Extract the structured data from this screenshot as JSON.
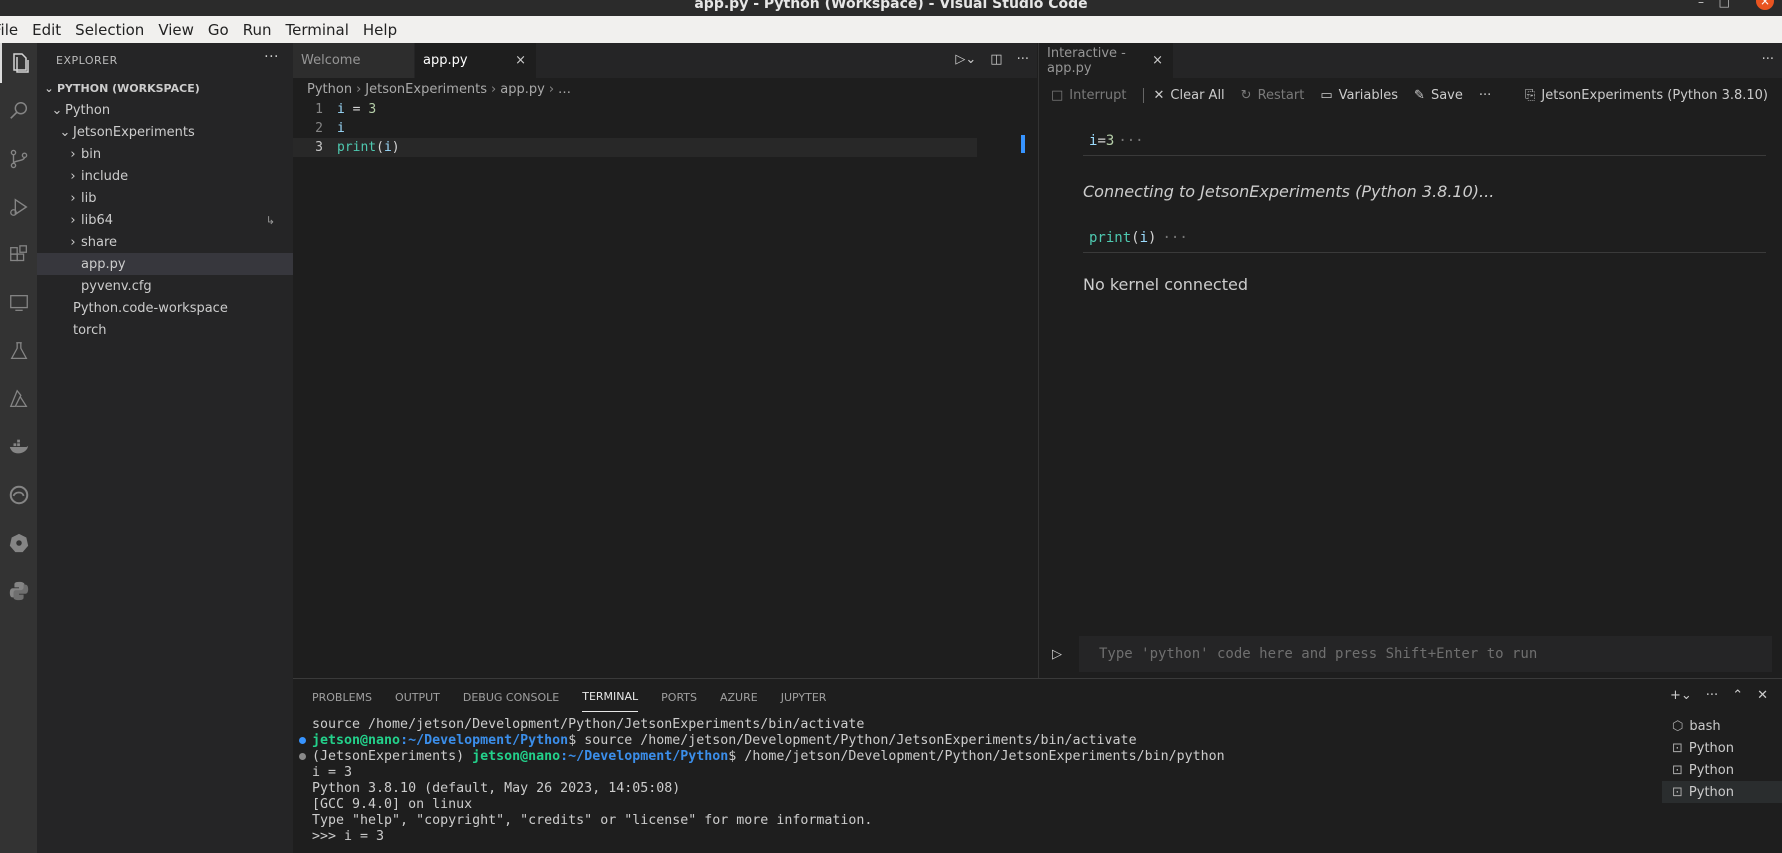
{
  "window": {
    "title": "app.py - Python (Workspace) - Visual Studio Code"
  },
  "menu": [
    "File",
    "Edit",
    "Selection",
    "View",
    "Go",
    "Run",
    "Terminal",
    "Help"
  ],
  "activity_icons": [
    "explorer-icon",
    "search-icon",
    "source-control-icon",
    "run-debug-icon",
    "extensions-icon",
    "remote-explorer-icon",
    "testing-icon",
    "azure-icon",
    "docker-icon",
    "edge-icon",
    "kubernetes-icon",
    "python-icon"
  ],
  "sidebar": {
    "title": "EXPLORER",
    "section": "PYTHON (WORKSPACE)",
    "items": [
      {
        "label": "Python",
        "indent": 1,
        "chev": "down"
      },
      {
        "label": "JetsonExperiments",
        "indent": 2,
        "chev": "down"
      },
      {
        "label": "bin",
        "indent": 3,
        "chev": "right"
      },
      {
        "label": "include",
        "indent": 3,
        "chev": "right"
      },
      {
        "label": "lib",
        "indent": 3,
        "chev": "right"
      },
      {
        "label": "lib64",
        "indent": 3,
        "chev": "right",
        "badge": "↳"
      },
      {
        "label": "share",
        "indent": 3,
        "chev": "right"
      },
      {
        "label": "app.py",
        "indent": 3,
        "chev": "",
        "selected": true
      },
      {
        "label": "pyvenv.cfg",
        "indent": 3,
        "chev": ""
      },
      {
        "label": "Python.code-workspace",
        "indent": 2,
        "chev": ""
      },
      {
        "label": "torch",
        "indent": 2,
        "chev": ""
      }
    ]
  },
  "editor": {
    "tabs": [
      {
        "label": "Welcome",
        "active": false
      },
      {
        "label": "app.py",
        "active": true,
        "close": "×"
      }
    ],
    "breadcrumb": [
      "Python",
      "JetsonExperiments",
      "app.py",
      "…"
    ],
    "lines": [
      {
        "num": "1",
        "parts": [
          [
            "var",
            "i"
          ],
          [
            "op",
            " = "
          ],
          [
            "num",
            "3"
          ]
        ]
      },
      {
        "num": "2",
        "parts": [
          [
            "var",
            "i"
          ]
        ]
      },
      {
        "num": "3",
        "parts": [
          [
            "fn",
            "print"
          ],
          [
            "op",
            "("
          ],
          [
            "var",
            "i"
          ],
          [
            "op",
            ")"
          ]
        ],
        "current": true
      }
    ]
  },
  "interactive": {
    "tab_label": "Interactive - app.py",
    "tab_close": "×",
    "toolbar": {
      "interrupt": "Interrupt",
      "clear_all": "Clear All",
      "restart": "Restart",
      "variables": "Variables",
      "save": "Save",
      "kernel": "JetsonExperiments (Python 3.8.10)"
    },
    "cells": [
      {
        "code": "i = 3"
      },
      {
        "output": "Connecting to JetsonExperiments (Python 3.8.10)...",
        "italic": true
      },
      {
        "code": "print(i)"
      },
      {
        "output": "No kernel connected",
        "italic": false
      }
    ],
    "placeholder": "Type 'python' code here and press Shift+Enter to run"
  },
  "panel": {
    "tabs": [
      "PROBLEMS",
      "OUTPUT",
      "DEBUG CONSOLE",
      "TERMINAL",
      "PORTS",
      "AZURE",
      "JUPYTER"
    ],
    "active_tab": "TERMINAL",
    "terminal_lines": [
      {
        "text": "source /home/jetson/Development/Python/JetsonExperiments/bin/activate"
      },
      {
        "dot": "#3794ff",
        "user": "jetson@nano",
        "path": ":~/Development/Python",
        "rest": "$ source /home/jetson/Development/Python/JetsonExperiments/bin/activate"
      },
      {
        "dot": "#888888",
        "prefix": "(JetsonExperiments) ",
        "user": "jetson@nano",
        "path": ":~/Development/Python",
        "rest": "$ /home/jetson/Development/Python/JetsonExperiments/bin/python"
      },
      {
        "text": "i = 3"
      },
      {
        "text": "Python 3.8.10 (default, May 26 2023, 14:05:08)"
      },
      {
        "text": "[GCC 9.4.0] on linux"
      },
      {
        "text": "Type \"help\", \"copyright\", \"credits\" or \"license\" for more information."
      },
      {
        "text": ">>> i = 3"
      }
    ],
    "terminals": [
      {
        "label": "bash",
        "icon": "bash-icon"
      },
      {
        "label": "Python",
        "icon": "terminal-icon"
      },
      {
        "label": "Python",
        "icon": "terminal-icon"
      },
      {
        "label": "Python",
        "icon": "terminal-icon",
        "selected": true
      }
    ]
  }
}
